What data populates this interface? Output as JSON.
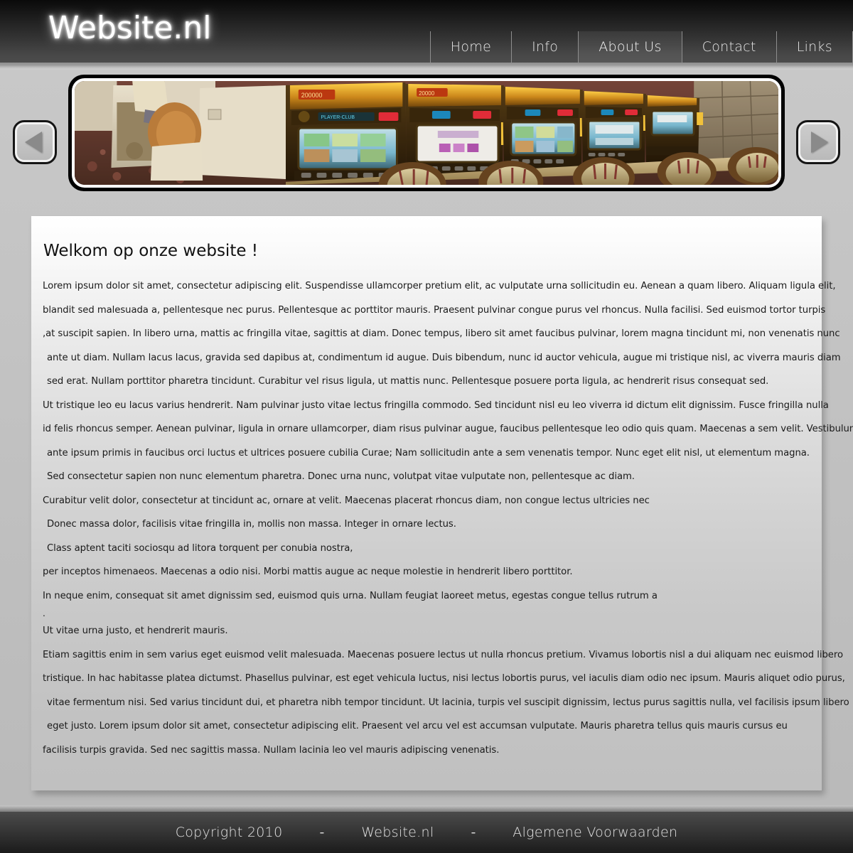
{
  "site": {
    "logo": "Website.nl"
  },
  "nav": {
    "items": [
      {
        "label": "Home",
        "active": false
      },
      {
        "label": "Info",
        "active": false
      },
      {
        "label": "About Us",
        "active": true
      },
      {
        "label": "Contact",
        "active": false
      },
      {
        "label": "Links",
        "active": false
      }
    ]
  },
  "slider": {
    "prev_label": "◀",
    "next_label": "▶",
    "image_alt": "casino-slot-machines-row"
  },
  "main": {
    "title": "Welkom op onze website !",
    "lines": [
      {
        "text": "Lorem ipsum dolor sit amet, consectetur adipiscing elit. Suspendisse ullamcorper pretium elit, ac vulputate urna sollicitudin eu. Aenean a quam libero. Aliquam ligula elit,",
        "indent": false
      },
      {
        "text": "blandit sed malesuada a, pellentesque nec purus. Pellentesque ac porttitor mauris. Praesent pulvinar congue purus vel rhoncus. Nulla facilisi. Sed euismod tortor turpis",
        "indent": false
      },
      {
        "text": ",at suscipit sapien. In libero urna, mattis ac fringilla vitae, sagittis at diam. Donec tempus, libero sit amet faucibus pulvinar, lorem magna tincidunt mi, non venenatis nunc",
        "indent": false
      },
      {
        "text": "ante ut diam. Nullam lacus lacus, gravida sed dapibus at, condimentum id augue. Duis bibendum, nunc id auctor vehicula, augue mi tristique nisl, ac viverra mauris diam",
        "indent": true
      },
      {
        "text": "sed erat. Nullam porttitor pharetra tincidunt. Curabitur vel risus ligula, ut mattis nunc. Pellentesque posuere porta ligula, ac hendrerit risus consequat sed.",
        "indent": true
      },
      {
        "text": "Ut tristique leo eu lacus varius hendrerit. Nam pulvinar justo vitae lectus fringilla commodo. Sed tincidunt nisl eu leo viverra id dictum elit dignissim. Fusce fringilla nulla",
        "indent": false
      },
      {
        "text": "id felis rhoncus semper. Aenean pulvinar, ligula in ornare ullamcorper, diam risus pulvinar augue, faucibus pellentesque leo odio quis quam. Maecenas a sem velit. Vestibulum",
        "indent": false
      },
      {
        "text": "ante ipsum primis in faucibus orci luctus et ultrices posuere cubilia Curae; Nam sollicitudin ante a sem venenatis tempor. Nunc eget elit nisl, ut elementum magna.",
        "indent": true
      },
      {
        "text": "Sed consectetur sapien non nunc elementum pharetra. Donec urna nunc, volutpat vitae vulputate non, pellentesque ac diam.",
        "indent": true
      },
      {
        "text": "Curabitur velit dolor, consectetur at tincidunt ac, ornare at velit. Maecenas placerat rhoncus diam, non congue lectus ultricies nec",
        "indent": false
      },
      {
        "text": "Donec massa dolor, facilisis vitae fringilla in, mollis non massa. Integer in ornare lectus.",
        "indent": true
      },
      {
        "text": "Class aptent taciti sociosqu ad litora torquent per conubia nostra,",
        "indent": true
      },
      {
        "text": "per inceptos himenaeos. Maecenas a odio nisi. Morbi mattis augue ac neque molestie in hendrerit libero porttitor.",
        "indent": false
      },
      {
        "text": "In neque enim, consequat sit amet dignissim sed, euismod quis urna. Nullam feugiat laoreet metus, egestas congue tellus rutrum a",
        "indent": false
      },
      {
        "text": ".",
        "indent": false,
        "dot": true
      },
      {
        "text": "Ut vitae urna justo, et hendrerit mauris.",
        "indent": false
      },
      {
        "text": "Etiam sagittis enim in sem varius eget euismod velit malesuada. Maecenas posuere lectus ut nulla rhoncus pretium. Vivamus lobortis nisl a dui aliquam nec euismod libero",
        "indent": false
      },
      {
        "text": "tristique. In hac habitasse platea dictumst. Phasellus pulvinar, est eget vehicula luctus, nisi lectus lobortis purus, vel iaculis diam odio nec ipsum. Mauris aliquet odio purus,",
        "indent": false
      },
      {
        "text": "vitae fermentum nisi. Sed varius tincidunt dui, et pharetra nibh tempor tincidunt. Ut lacinia, turpis vel suscipit dignissim, lectus purus sagittis nulla, vel facilisis ipsum libero",
        "indent": true
      },
      {
        "text": "eget justo. Lorem ipsum dolor sit amet, consectetur adipiscing elit. Praesent vel arcu vel est accumsan vulputate. Mauris pharetra tellus quis mauris cursus eu",
        "indent": true
      },
      {
        "text": "facilisis turpis gravida. Sed nec sagittis massa. Nullam lacinia leo vel mauris adipiscing venenatis.",
        "indent": false
      }
    ]
  },
  "footer": {
    "copyright": "Copyright 2010",
    "separator1": "-",
    "sitename": "Website.nl",
    "separator2": "-",
    "terms": "Algemene Voorwaarden"
  },
  "colors": {
    "header_dark": "#0a0a0a",
    "header_light": "#4c4c4c",
    "page_bg": "#c2c2c2",
    "nav_text": "#e6e6e6",
    "body_text": "#1a1a1a"
  }
}
